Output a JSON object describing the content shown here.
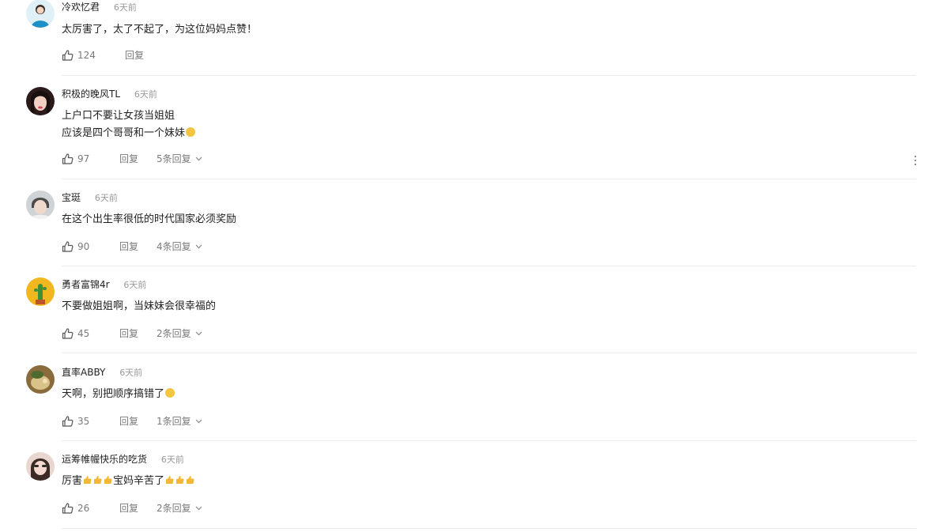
{
  "colors": {
    "text": "#222222",
    "muted": "#9a9a9a",
    "action": "#7a7a7a",
    "divider": "#ececec"
  },
  "icons": {
    "like": "thumbs-up-icon",
    "expand": "chevron-down-icon",
    "more": "more-vertical-icon"
  },
  "comments": [
    {
      "username": "冷欢忆君",
      "time": "6天前",
      "lines": [
        "太厉害了，太了不起了，为这位妈妈点赞！"
      ],
      "likes": "124",
      "reply_label": "回复",
      "more_replies": ""
    },
    {
      "username": "积极的晚风TL",
      "time": "6天前",
      "lines": [
        "上户口不要让女孩当姐姐",
        "应该是四个哥哥和一个妹妹"
      ],
      "likes": "97",
      "reply_label": "回复",
      "more_replies": "5条回复"
    },
    {
      "username": "宝珽",
      "time": "6天前",
      "lines": [
        "在这个出生率很低的时代国家必须奖励"
      ],
      "likes": "90",
      "reply_label": "回复",
      "more_replies": "4条回复"
    },
    {
      "username": "勇者富锦4r",
      "time": "6天前",
      "lines": [
        "不要做姐姐啊，当妹妹会很幸福的"
      ],
      "likes": "45",
      "reply_label": "回复",
      "more_replies": "2条回复"
    },
    {
      "username": "直率ABBY",
      "time": "6天前",
      "lines": [
        "天啊，别把顺序搞错了"
      ],
      "likes": "35",
      "reply_label": "回复",
      "more_replies": "1条回复"
    },
    {
      "username": "运筹帷幄快乐的吃货",
      "time": "6天前",
      "lines": [
        "厉害",
        "宝妈辛苦了"
      ],
      "likes": "26",
      "reply_label": "回复",
      "more_replies": "2条回复"
    }
  ]
}
